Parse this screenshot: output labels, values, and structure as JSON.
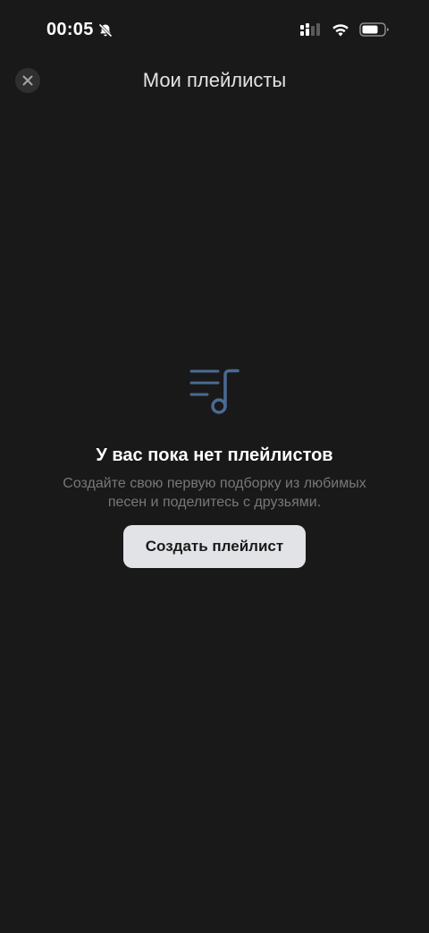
{
  "status_bar": {
    "time": "00:05",
    "icons": [
      "bell-off-icon",
      "cellular-signal-icon",
      "wifi-icon",
      "battery-icon"
    ]
  },
  "nav": {
    "close_icon": "close-icon",
    "title": "Мои плейлисты"
  },
  "empty_state": {
    "icon": "playlist-music-icon",
    "title": "У вас пока нет плейлистов",
    "subtitle_line1": "Создайте свою первую подборку из любимых",
    "subtitle_line2": "песен и поделитесь с друзьями.",
    "button_label": "Создать плейлист"
  },
  "colors": {
    "background": "#191919",
    "accent_icon": "#4a6a93",
    "button_bg": "#e1e3e6",
    "subtitle_text": "#76787a"
  }
}
